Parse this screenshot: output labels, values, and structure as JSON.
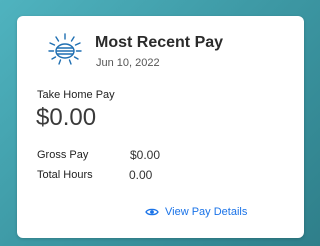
{
  "card": {
    "title": "Most Recent Pay",
    "date": "Jun 10, 2022",
    "take_home_label": "Take Home Pay",
    "take_home_value": "$0.00",
    "rows": [
      {
        "label": "Gross Pay",
        "value": "$0.00"
      },
      {
        "label": "Total Hours",
        "value": "0.00"
      }
    ],
    "link_label": "View Pay Details"
  },
  "icons": {
    "header": "sun-icon",
    "link": "eye-icon"
  },
  "colors": {
    "background": "#3e9aa6",
    "icon_blue": "#1f6fb2",
    "link_blue": "#1a73e8"
  }
}
